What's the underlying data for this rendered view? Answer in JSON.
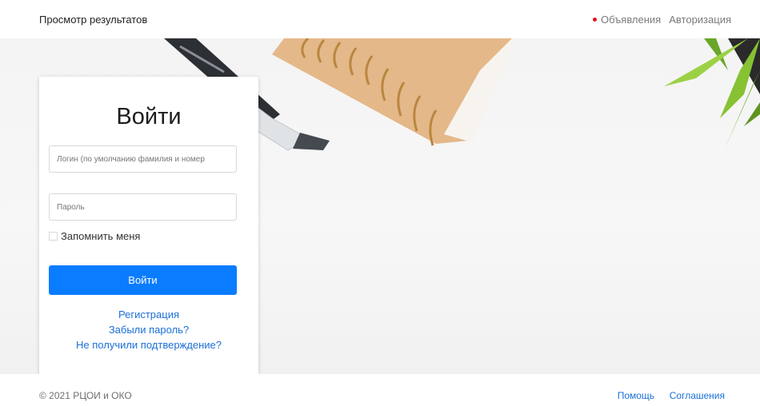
{
  "header": {
    "brand": "Просмотр результатов",
    "nav": [
      {
        "label": "Объявления"
      },
      {
        "label": "Авторизация"
      }
    ]
  },
  "login": {
    "title": "Войти",
    "login_placeholder": "Логин (по умолчанию фамилия и номер",
    "password_placeholder": "Пароль",
    "remember_label": "Запомнить меня",
    "submit_label": "Войти",
    "links": [
      {
        "label": "Регистрация"
      },
      {
        "label": "Забыли пароль?"
      },
      {
        "label": "Не получили подтверждение?"
      }
    ]
  },
  "footer": {
    "copyright": "© 2021 РЦОИ и ОКО",
    "links": [
      {
        "label": "Помощь"
      },
      {
        "label": "Соглашения"
      }
    ]
  },
  "colors": {
    "accent": "#0a7cff",
    "link": "#1b6fd6",
    "notification_dot": "#e0141e"
  }
}
